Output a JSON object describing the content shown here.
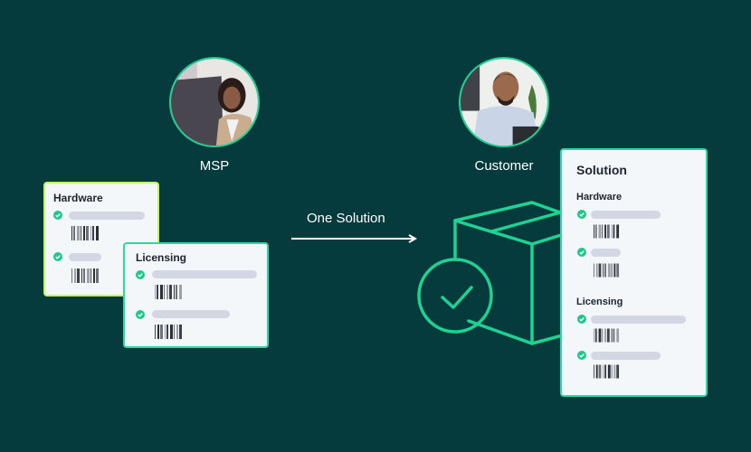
{
  "diagram": {
    "actors": {
      "msp": {
        "label": "MSP",
        "photo": "woman-at-laptop-photo"
      },
      "customer": {
        "label": "Customer",
        "photo": "smiling-man-with-pen-photo"
      }
    },
    "flow": {
      "label": "One Solution",
      "icon": "arrow-right-icon"
    },
    "msp_cards": {
      "hardware": {
        "title": "Hardware",
        "items": [
          {
            "status": "checked"
          },
          {
            "status": "checked"
          }
        ]
      },
      "licensing": {
        "title": "Licensing",
        "items": [
          {
            "status": "checked"
          },
          {
            "status": "checked"
          }
        ]
      }
    },
    "solution_card": {
      "title": "Solution",
      "sections": [
        {
          "title": "Hardware",
          "items": [
            {
              "status": "checked"
            },
            {
              "status": "checked"
            }
          ]
        },
        {
          "title": "Licensing",
          "items": [
            {
              "status": "checked"
            },
            {
              "status": "checked"
            }
          ]
        }
      ]
    },
    "illustration": {
      "icon": "package-box-check-icon"
    },
    "colors": {
      "background": "#063b3e",
      "accent_green": "#1ed391",
      "hardware_border": "#c6f25c",
      "card_bg": "#f4f7fa",
      "placeholder_pill": "#d3d7e3"
    }
  }
}
